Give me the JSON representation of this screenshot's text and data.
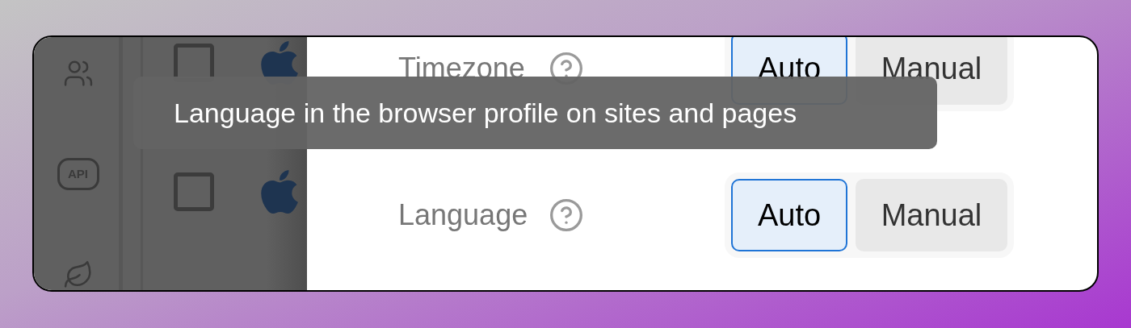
{
  "sidebar": {
    "items": [
      {
        "kind": "people"
      },
      {
        "kind": "api",
        "label": "API"
      },
      {
        "kind": "leaf"
      }
    ]
  },
  "profiles": [
    {
      "checked": false
    },
    {
      "checked": false
    }
  ],
  "settings": [
    {
      "label": "Timezone",
      "options": [
        {
          "label": "Auto",
          "selected": true
        },
        {
          "label": "Manual",
          "selected": false
        }
      ]
    },
    {
      "label": "Language",
      "options": [
        {
          "label": "Auto",
          "selected": true
        },
        {
          "label": "Manual",
          "selected": false
        }
      ]
    }
  ],
  "tooltip": {
    "text": "Language in the browser profile on sites and pages"
  }
}
